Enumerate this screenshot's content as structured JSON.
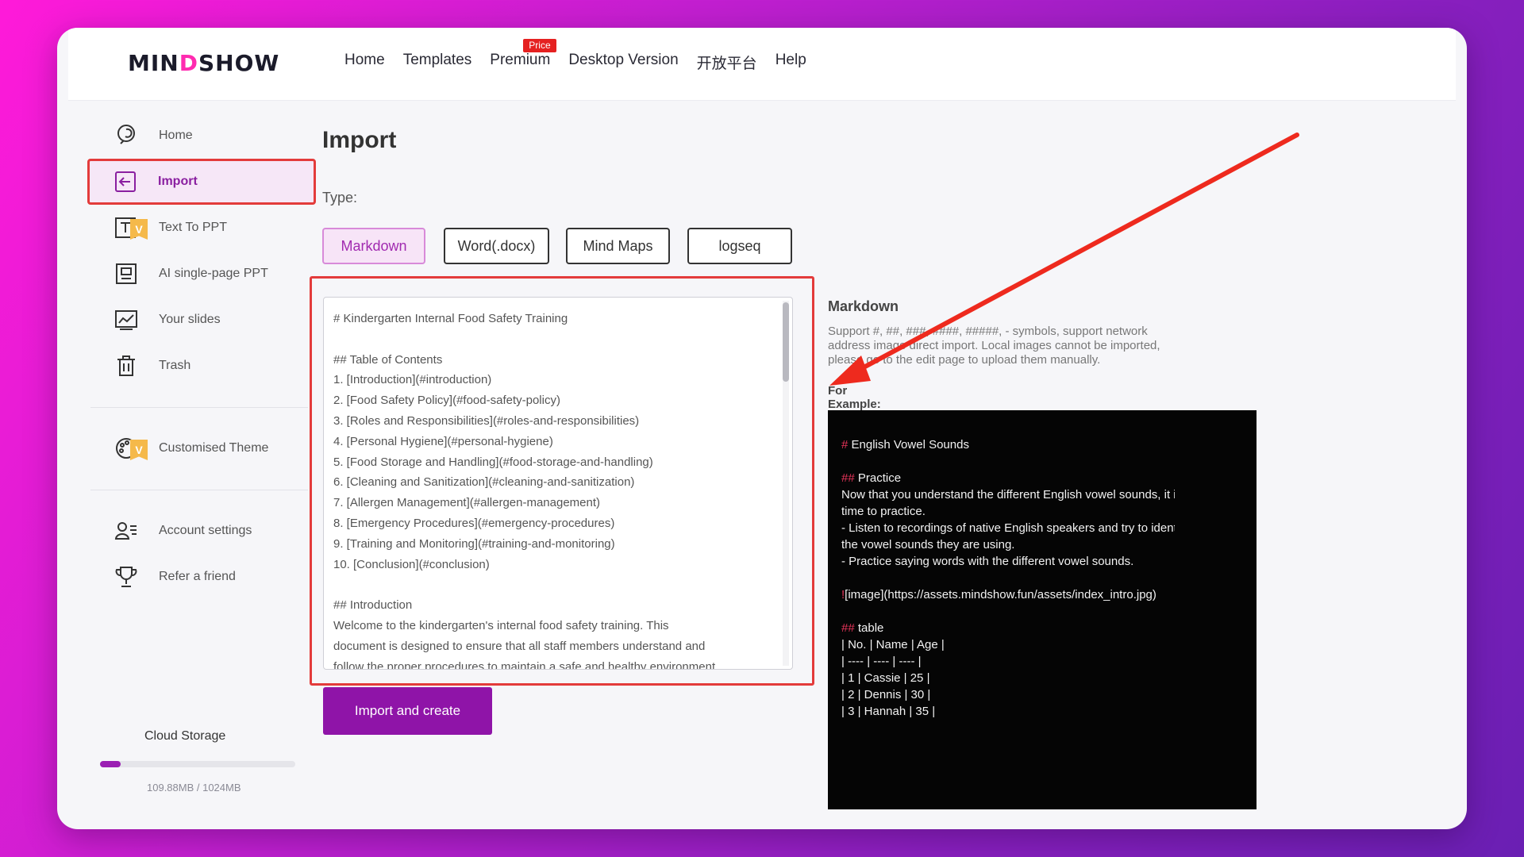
{
  "app": {
    "logo_prefix": "MIN",
    "logo_accent": "D",
    "logo_suffix": "SHOW"
  },
  "nav": {
    "items": [
      "Home",
      "Templates",
      "Premium",
      "Desktop Version",
      "开放平台",
      "Help"
    ],
    "premium_badge": "Price"
  },
  "sidebar": {
    "items": [
      {
        "label": "Home",
        "icon": "home-icon"
      },
      {
        "label": "Import",
        "icon": "import-icon",
        "active": true
      },
      {
        "label": "Text To PPT",
        "icon": "text-icon",
        "badge": "V"
      },
      {
        "label": "AI single-page PPT",
        "icon": "slide-icon"
      },
      {
        "label": "Your slides",
        "icon": "slides-icon"
      },
      {
        "label": "Trash",
        "icon": "trash-icon"
      },
      {
        "label": "Customised Theme",
        "icon": "palette-icon",
        "badge": "V"
      },
      {
        "label": "Account settings",
        "icon": "account-icon"
      },
      {
        "label": "Refer a friend",
        "icon": "trophy-icon"
      }
    ],
    "storage": {
      "title": "Cloud Storage",
      "usage_text": "109.88MB / 1024MB",
      "fraction_used": 0.107
    }
  },
  "main": {
    "title": "Import",
    "type_label": "Type:",
    "types": [
      "Markdown",
      "Word(.docx)",
      "Mind Maps",
      "logseq"
    ],
    "active_type": "Markdown",
    "editor_lines": [
      "# Kindergarten Internal Food Safety Training",
      "",
      "## Table of Contents",
      "1. [Introduction](#introduction)",
      "2. [Food Safety Policy](#food-safety-policy)",
      "3. [Roles and Responsibilities](#roles-and-responsibilities)",
      "4. [Personal Hygiene](#personal-hygiene)",
      "5. [Food Storage and Handling](#food-storage-and-handling)",
      "6. [Cleaning and Sanitization](#cleaning-and-sanitization)",
      "7. [Allergen Management](#allergen-management)",
      "8. [Emergency Procedures](#emergency-procedures)",
      "9. [Training and Monitoring](#training-and-monitoring)",
      "10. [Conclusion](#conclusion)",
      "",
      "## Introduction",
      "Welcome to the kindergarten's internal food safety training. This",
      "document is designed to ensure that all staff members understand and",
      "follow the proper procedures to maintain a safe and healthy environment"
    ],
    "import_button": "Import and create"
  },
  "help": {
    "title": "Markdown",
    "description": "Support #, ##, ###, ####, #####, - symbols, support network address image direct import. Local images cannot be imported, please go to the edit page to upload them manually.",
    "example_label": "For Example:",
    "example_lines": [
      {
        "hash": "#",
        "text": " English Vowel Sounds"
      },
      {
        "hash": "",
        "text": ""
      },
      {
        "hash": "##",
        "text": " Practice"
      },
      {
        "hash": "",
        "text": " Now that you understand the different English vowel sounds, it is"
      },
      {
        "hash": "",
        "text": " time to practice."
      },
      {
        "hash": "",
        "text": "- Listen to recordings of native English speakers and try to identify"
      },
      {
        "hash": "",
        "text": " the vowel sounds they are using."
      },
      {
        "hash": "",
        "text": "- Practice saying words with the different vowel sounds."
      },
      {
        "hash": "",
        "text": ""
      },
      {
        "hash": "!",
        "text": "[image](https://assets.mindshow.fun/assets/index_intro.jpg)"
      },
      {
        "hash": "",
        "text": ""
      },
      {
        "hash": "##",
        "text": " table"
      },
      {
        "hash": "",
        "text": " | No. | Name | Age |"
      },
      {
        "hash": "",
        "text": " | ---- | ---- | ---- |"
      },
      {
        "hash": "",
        "text": " | 1 | Cassie | 25 |"
      },
      {
        "hash": "",
        "text": " | 2 | Dennis | 30 |"
      },
      {
        "hash": "",
        "text": " | 3 | Hannah | 35 |"
      }
    ]
  },
  "colors": {
    "accent": "#8f14a8",
    "highlight_red": "#e33b3b",
    "badge_yellow": "#f5b94a"
  }
}
